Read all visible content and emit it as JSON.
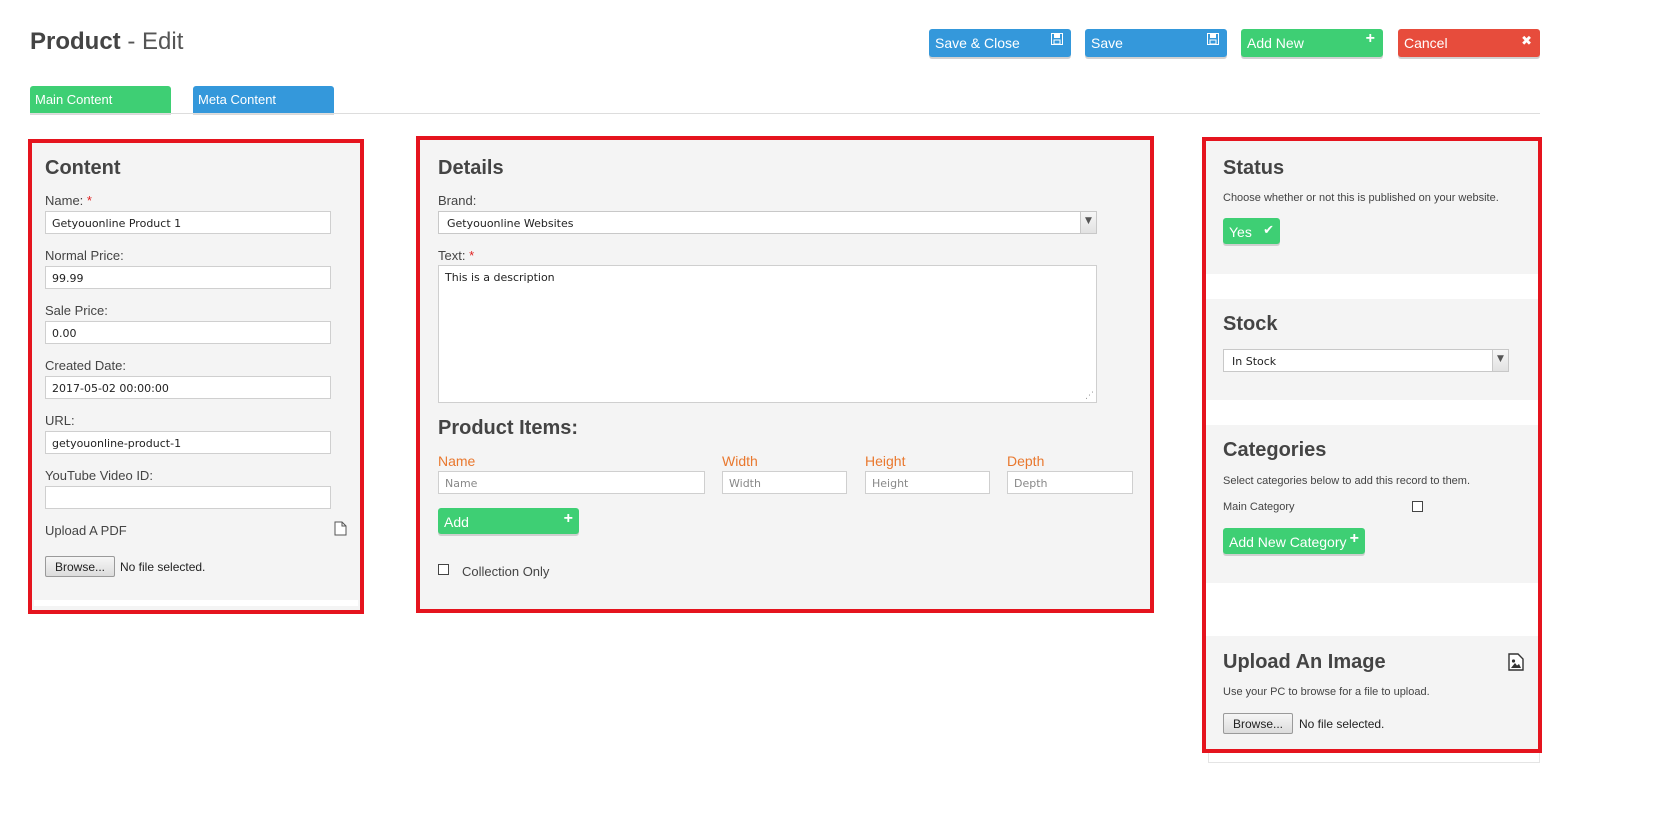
{
  "header": {
    "title_bold": "Product",
    "title_sub": " - Edit"
  },
  "toolbar": {
    "save_close": "Save & Close",
    "save": "Save",
    "add_new": "Add New",
    "cancel": "Cancel"
  },
  "tabs": {
    "main": "Main Content",
    "meta": "Meta Content"
  },
  "content": {
    "heading": "Content",
    "name_label": "Name:",
    "name_value": "Getyouonline Product 1",
    "normal_price_label": "Normal Price:",
    "normal_price_value": "99.99",
    "sale_price_label": "Sale Price:",
    "sale_price_value": "0.00",
    "created_date_label": "Created Date:",
    "created_date_value": "2017-05-02 00:00:00",
    "url_label": "URL:",
    "url_value": "getyouonline-product-1",
    "youtube_label": "YouTube Video ID:",
    "youtube_value": "",
    "upload_pdf_label": "Upload A PDF",
    "browse": "Browse...",
    "no_file": "No file selected."
  },
  "details": {
    "heading": "Details",
    "brand_label": "Brand:",
    "brand_value": "Getyouonline Websites",
    "text_label": "Text:",
    "text_value": "This is a description",
    "product_items_heading": "Product Items:",
    "columns": {
      "name": "Name",
      "width": "Width",
      "height": "Height",
      "depth": "Depth"
    },
    "placeholders": {
      "name": "Name",
      "width": "Width",
      "height": "Height",
      "depth": "Depth"
    },
    "add_button": "Add",
    "collection_only": "Collection Only"
  },
  "status": {
    "heading": "Status",
    "description": "Choose whether or not this is published on your website.",
    "toggle": "Yes"
  },
  "stock": {
    "heading": "Stock",
    "value": "In Stock"
  },
  "categories": {
    "heading": "Categories",
    "description": "Select categories below to add this record to them.",
    "main_category": "Main Category",
    "add_new_category": "Add New Category"
  },
  "upload_image": {
    "heading": "Upload An Image",
    "description": "Use your PC to browse for a file to upload.",
    "browse": "Browse...",
    "no_file": "No file selected."
  },
  "colors": {
    "blue": "#3498db",
    "green": "#3ecf74",
    "red": "#e74c3c",
    "highlight": "#e5141e",
    "orange": "#e9782e"
  }
}
